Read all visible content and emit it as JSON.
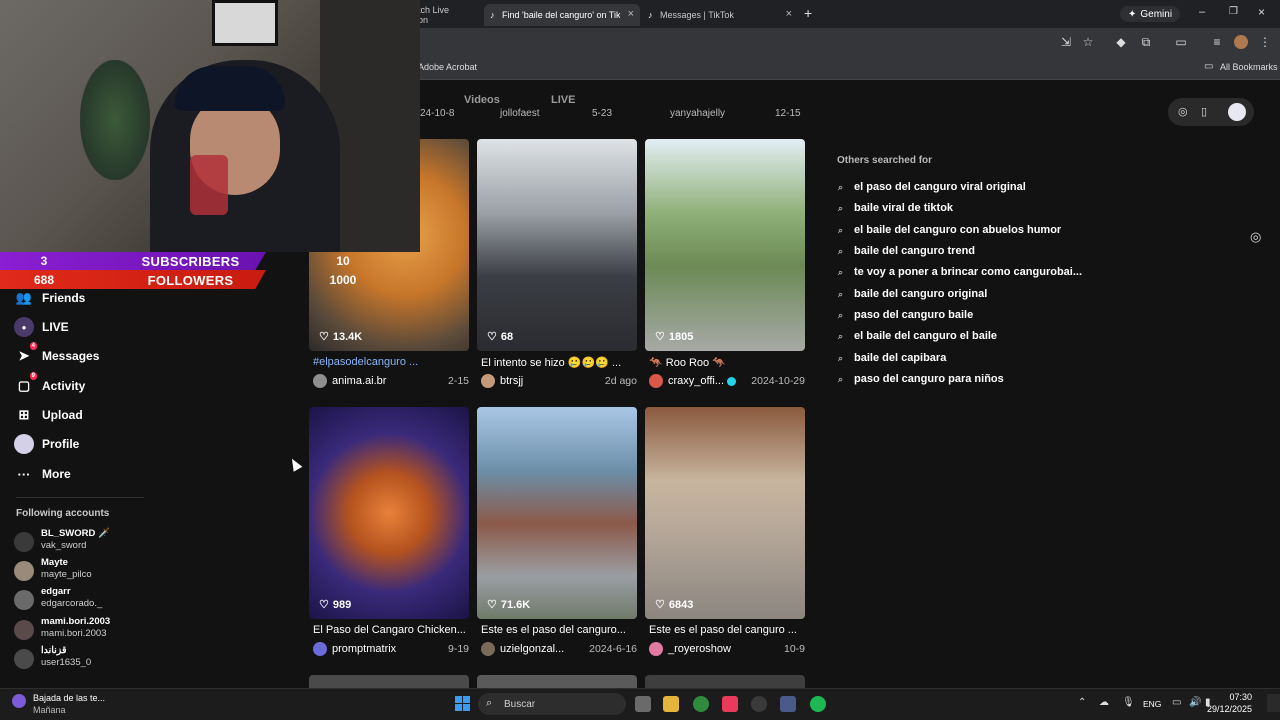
{
  "browser": {
    "tabs": [
      {
        "label": "tch Live on",
        "active": false
      },
      {
        "label": "Find 'baile del canguro' on TikTok",
        "active": true
      },
      {
        "label": "Messages | TikTok",
        "active": false
      }
    ],
    "new_tab": "+",
    "gemini_label": "Gemini",
    "bookmark_item": "Adobe Acrobat",
    "all_bookmarks": "All Bookmarks"
  },
  "overlay": {
    "subscribers_count": "3",
    "subscribers_goal": "10",
    "subscribers_label": "SUBSCRIBERS",
    "followers_count": "688",
    "followers_goal": "1000",
    "followers_label": "FOLLOWERS"
  },
  "sidebar": {
    "items": [
      {
        "label": "Friends",
        "icon": "friends-icon"
      },
      {
        "label": "LIVE",
        "icon": "live-icon"
      },
      {
        "label": "Messages",
        "icon": "messages-icon",
        "badge": "4"
      },
      {
        "label": "Activity",
        "icon": "activity-icon",
        "badge": "9"
      },
      {
        "label": "Upload",
        "icon": "upload-icon"
      },
      {
        "label": "Profile",
        "icon": "profile-icon"
      },
      {
        "label": "More",
        "icon": "more-icon"
      }
    ],
    "following_title": "Following accounts",
    "following": [
      {
        "name": "BL_SWORD 🗡️",
        "handle": "vak_sword"
      },
      {
        "name": "Mayte",
        "handle": "mayte_pilco"
      },
      {
        "name": "edgarr",
        "handle": "edgarcorado._"
      },
      {
        "name": "mami.bori.2003",
        "handle": "mami.bori.2003"
      },
      {
        "name": "قزناندا",
        "handle": "user1635_0"
      }
    ]
  },
  "content_tabs": {
    "videos": "Videos",
    "live": "LIVE"
  },
  "top_row_partial": [
    "24-10-8",
    "jollofaest",
    "5-23",
    "yanyahajelly",
    "12-15"
  ],
  "videos": [
    {
      "likes": "13.4K",
      "title": "#elpasodelcanguro ...",
      "author": "anima.ai.br",
      "date": "2-15",
      "title_is_tag": true
    },
    {
      "likes": "68",
      "title": "El intento se hizo 🥲🥲🥲 ...",
      "author": "btrsjj",
      "date": "2d ago"
    },
    {
      "likes": "1805",
      "title": "🦘 Roo Roo 🦘",
      "author": "craxy_offi...",
      "date": "2024-10-29",
      "verified": true
    },
    {
      "likes": "989",
      "title": "El Paso del Cangaro Chicken...",
      "author": "promptmatrix",
      "date": "9-19"
    },
    {
      "likes": "71.6K",
      "title": "Este es el paso del canguro...",
      "author": "uzielgonzal...",
      "date": "2024-6-16"
    },
    {
      "likes": "6843",
      "title": "Este es el paso del canguro ...",
      "author": "_royeroshow",
      "date": "10-9"
    }
  ],
  "others_searched": {
    "title": "Others searched for",
    "items": [
      "el paso del canguro viral original",
      "baile viral de tiktok",
      "el baile del canguro con abuelos humor",
      "baile del canguro trend",
      "te voy a poner a brincar como cangurobai...",
      "baile del canguro original",
      "paso del canguro baile",
      "el baile del canguro el baile",
      "baile del capibara",
      "paso del canguro para niños"
    ]
  },
  "taskbar": {
    "weather_title": "Bajada de las te...",
    "weather_sub": "Mañana",
    "search_placeholder": "Buscar",
    "language": "ENG",
    "time": "07:30",
    "date": "29/12/2025"
  },
  "colors": {
    "accent": "#fe2c55",
    "subs_banner": "#8a1fd3",
    "followers_banner": "#e02a1a",
    "tag": "#8ab4f8"
  }
}
